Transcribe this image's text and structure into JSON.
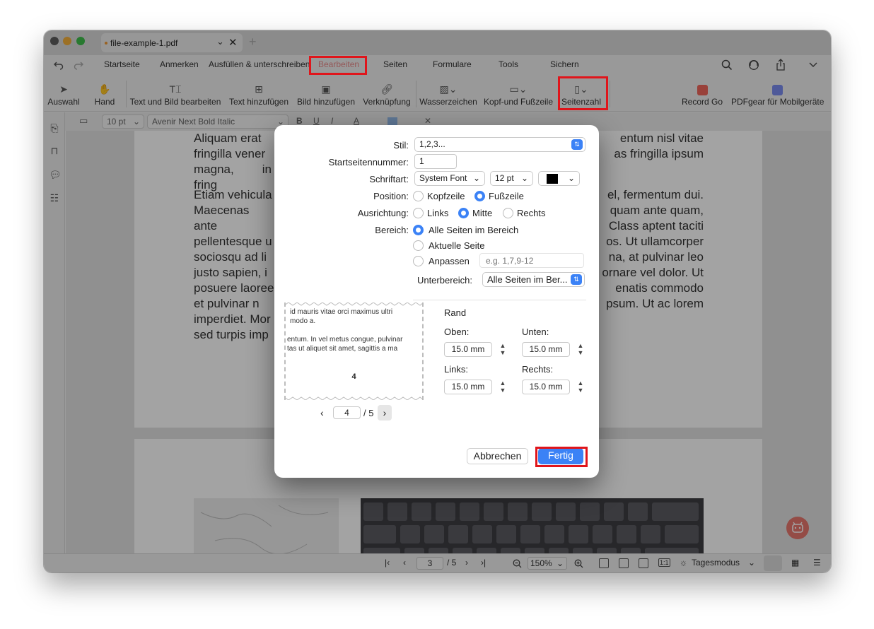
{
  "window": {
    "tab_title": "file-example-1.pdf",
    "tab_chevron": "⌄",
    "tab_close": "✕",
    "new_tab": "+"
  },
  "menubar": {
    "items": [
      "Startseite",
      "Anmerken",
      "Ausfüllen & unterschreiben",
      "Bearbeiten",
      "Seiten",
      "Formulare",
      "Tools",
      "Sichern"
    ]
  },
  "toolbar": {
    "items": [
      "Auswahl",
      "Hand",
      "Text und Bild bearbeiten",
      "Text hinzufügen",
      "Bild hinzufügen",
      "Verknüpfung",
      "Wasserzeichen",
      "Kopf-und Fußzeile",
      "Seitenzahl",
      "Record Go",
      "PDFgear für Mobilgeräte"
    ]
  },
  "format_bar": {
    "font_size": "10 pt",
    "font_name": "Avenir Next Bold Italic",
    "bold": "B",
    "underline": "U",
    "italic": "I",
    "text_color": "A"
  },
  "document": {
    "page3_para1": [
      "Aliquam erat",
      "entum nisl vitae",
      "fringilla vener",
      "as fringilla ipsum",
      "magna, in fring"
    ],
    "page3_para2_left": [
      "Etiam vehicula",
      "Maecenas ante",
      "pellentesque u",
      "sociosqu ad li",
      "justo sapien, i",
      "posuere laoree",
      "et pulvinar n",
      "imperdiet. Mor",
      "sed turpis imp"
    ],
    "page3_para2_right": [
      "el, fermentum dui.",
      "quam ante quam,",
      "Class aptent taciti",
      "os. Ut ullamcorper",
      "na, at pulvinar leo",
      "ornare vel dolor. Ut",
      "enatis commodo",
      "psum. Ut ac lorem",
      ""
    ]
  },
  "statusbar": {
    "current_page": "3",
    "total_pages": "/ 5",
    "zoom": "150%",
    "mode": "Tagesmodus",
    "fit_label": "1:1"
  },
  "dialog": {
    "stil_label": "Stil:",
    "stil_value": "1,2,3...",
    "start_label": "Startseitennummer:",
    "start_value": "1",
    "font_label": "Schriftart:",
    "font_value": "System Font",
    "font_size": "12 pt",
    "color": "#000000",
    "position_label": "Position:",
    "position_options": [
      "Kopfzeile",
      "Fußzeile"
    ],
    "position_selected": "Fußzeile",
    "align_label": "Ausrichtung:",
    "align_options": [
      "Links",
      "Mitte",
      "Rechts"
    ],
    "align_selected": "Mitte",
    "range_label": "Bereich:",
    "range_options": [
      "Alle Seiten im Bereich",
      "Aktuelle Seite",
      "Anpassen"
    ],
    "range_selected": "Alle Seiten im Bereich",
    "custom_placeholder": "e.g. 1,7,9-12",
    "subrange_label": "Unterbereich:",
    "subrange_value": "Alle Seiten im Ber...",
    "preview_lines": [
      "id mauris vitae orci maximus ultri",
      "modo a.",
      "entum. In vel metus congue, pulvinar",
      "tas ut aliquet sit amet, sagittis a ma"
    ],
    "preview_page_number": "4",
    "preview_page": "4",
    "preview_total": "/ 5",
    "margin_title": "Rand",
    "top_label": "Oben:",
    "top_value": "15.0 mm",
    "bottom_label": "Unten:",
    "bottom_value": "15.0 mm",
    "left_label": "Links:",
    "left_value": "15.0 mm",
    "right_label": "Rechts:",
    "right_value": "15.0 mm",
    "cancel": "Abbrechen",
    "done": "Fertig"
  },
  "colors": {
    "accent": "#3b82f6",
    "highlight": "#e0151b",
    "bearbeiten": "#e88a8a"
  }
}
